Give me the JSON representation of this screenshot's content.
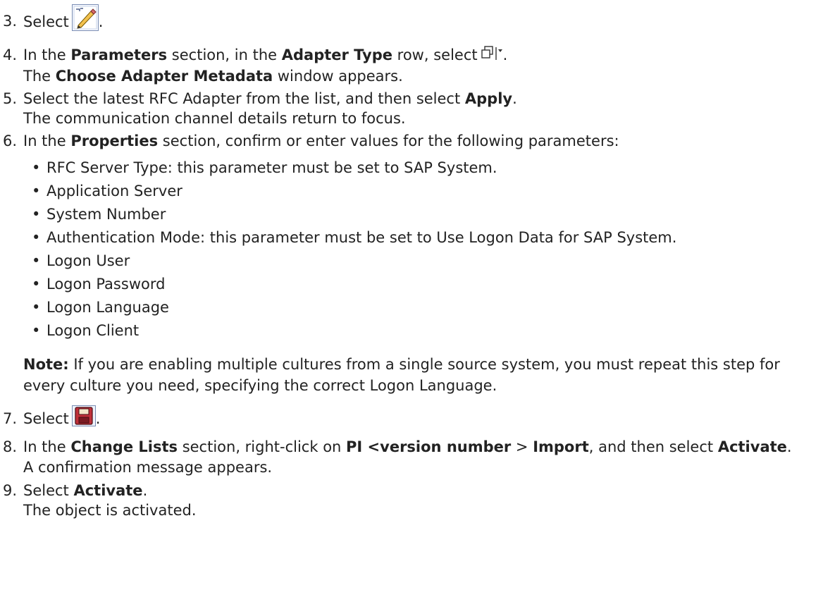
{
  "steps": [
    {
      "number": "3.",
      "text": "Select",
      "after_icon": ".",
      "icon": "edit-pencil-icon"
    },
    {
      "number": "4.",
      "p1": "In the ",
      "b1": "Parameters",
      "p2": " section, in the ",
      "b2": "Adapter Type",
      "p3": " row, select",
      "after_icon": ".",
      "icon": "choose-metadata-dropdown-icon",
      "line2_pre": "The ",
      "line2_bold": "Choose Adapter Metadata",
      "line2_post": " window appears."
    },
    {
      "number": "5.",
      "p1": "Select the latest RFC Adapter from the list, and then select ",
      "b1": "Apply",
      "p2": ".",
      "line2": "The communication channel details return to focus."
    },
    {
      "number": "6.",
      "p1": "In the ",
      "b1": "Properties",
      "p2": " section, confirm or enter values for the following parameters:",
      "bullets": [
        "RFC Server Type: this parameter must be set to SAP System.",
        "Application Server",
        "System Number",
        "Authentication Mode: this parameter must be set to Use Logon Data for SAP System.",
        "Logon User",
        "Logon Password",
        "Logon Language",
        "Logon Client"
      ],
      "note_label": "Note:",
      "note_text": " If you are enabling multiple cultures from a single source system, you must repeat this step for every culture you need, specifying the correct Logon Language."
    },
    {
      "number": "7.",
      "text": "Select",
      "after_icon": ".",
      "icon": "save-disk-icon"
    },
    {
      "number": "8.",
      "p1": "In the ",
      "b1": "Change Lists",
      "p2": " section, right-click on ",
      "b2": "PI <version number",
      "p3": " > ",
      "b3": "Import",
      "p4": ", and then select ",
      "b4": "Activate",
      "p5": ".",
      "line2": "A confirmation message appears."
    },
    {
      "number": "9.",
      "p1": "Select ",
      "b1": "Activate",
      "p2": ".",
      "line2": "The object is activated."
    }
  ],
  "colors": {
    "text": "#222222",
    "icon_border": "#7a8db3",
    "save_icon": "#c0303a"
  }
}
